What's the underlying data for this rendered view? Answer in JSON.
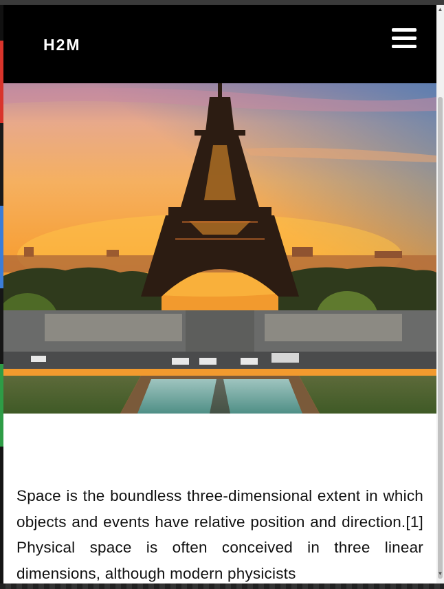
{
  "brand": "H2M",
  "menu_icon": "hamburger-menu-icon",
  "hero_image": "eiffel-tower-sunset-photo",
  "article": {
    "paragraph": "Space is the boundless three-dimensional extent in which objects and events have relative position and direction.[1] Physical space is often conceived in three linear dimensions, although modern physicists"
  },
  "colors": {
    "navbar": "#000000",
    "page": "#ffffff",
    "text": "#111111"
  }
}
